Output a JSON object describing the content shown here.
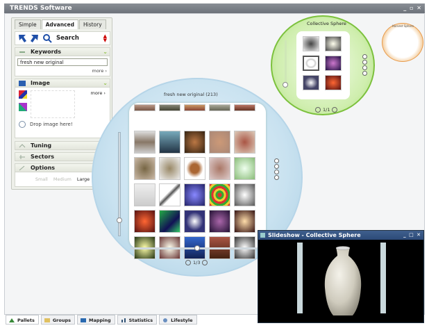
{
  "window": {
    "title": "TRENDS Software",
    "controls": "_ ▫ ✕"
  },
  "left_panel": {
    "tabs": [
      {
        "label": "Simple"
      },
      {
        "label": "Advanced"
      },
      {
        "label": "History"
      }
    ],
    "search_label": "Search",
    "keywords": {
      "title": "Keywords",
      "value": "fresh new original",
      "more": "more ›"
    },
    "image": {
      "title": "Image",
      "more": "more ›",
      "drop": "Drop image here!"
    },
    "tuning": {
      "title": "Tuning"
    },
    "sectors": {
      "title": "Sectors"
    },
    "options": {
      "title": "Options",
      "sizes": [
        "Small",
        "Medium",
        "Large"
      ]
    }
  },
  "sphere_main": {
    "title": "fresh new original (213)",
    "pager": "1/3"
  },
  "sphere_collective": {
    "title": "Collective Sphere",
    "pager": "1/1"
  },
  "sphere_mini": {
    "title": "Harvest Sphere"
  },
  "slideshow": {
    "title": "Slideshow - Collective Sphere",
    "controls": "_ □ ✕"
  },
  "bottom_tabs": [
    {
      "label": "Pallets"
    },
    {
      "label": "Groups"
    },
    {
      "label": "Mapping"
    },
    {
      "label": "Statistics"
    },
    {
      "label": "Lifestyle"
    }
  ],
  "colors": {
    "main_sphere": "#c9e2f0",
    "collective_sphere": "#a8dc74",
    "mini_sphere": "#eda65a",
    "slideshow_title": "#2c4a78"
  }
}
